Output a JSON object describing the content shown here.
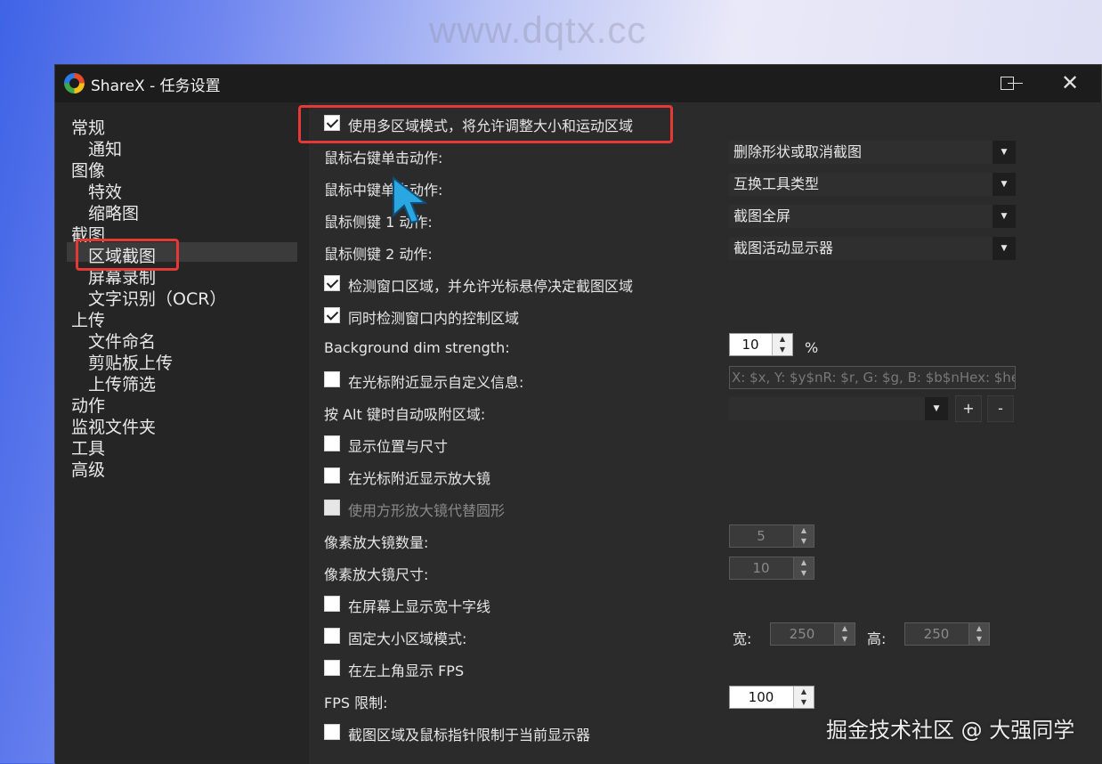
{
  "watermark_top": "www.dqtx.cc",
  "window": {
    "title": "ShareX - 任务设置"
  },
  "sidebar": {
    "items": [
      {
        "label": "常规"
      },
      {
        "label": "通知"
      },
      {
        "label": "图像"
      },
      {
        "label": "特效"
      },
      {
        "label": "缩略图"
      },
      {
        "label": "截图"
      },
      {
        "label": "区域截图"
      },
      {
        "label": "屏幕录制"
      },
      {
        "label": "文字识别（OCR）"
      },
      {
        "label": "上传"
      },
      {
        "label": "文件命名"
      },
      {
        "label": "剪贴板上传"
      },
      {
        "label": "上传筛选"
      },
      {
        "label": "动作"
      },
      {
        "label": "监视文件夹"
      },
      {
        "label": "工具"
      },
      {
        "label": "高级"
      }
    ],
    "selected": "区域截图"
  },
  "settings": {
    "multi_region_mode": {
      "label": "使用多区域模式，将允许调整大小和运动区域",
      "checked": true
    },
    "right_click": {
      "label": "鼠标右键单击动作:",
      "value": "删除形状或取消截图"
    },
    "middle_click": {
      "label": "鼠标中键单击动作:",
      "value": "互换工具类型"
    },
    "x1_click": {
      "label": "鼠标侧键 1 动作:",
      "value": "截图全屏"
    },
    "x2_click": {
      "label": "鼠标侧键 2 动作:",
      "value": "截图活动显示器"
    },
    "detect_windows": {
      "label": "检测窗口区域，并允许光标悬停决定截图区域",
      "checked": true
    },
    "detect_controls": {
      "label": "同时检测窗口内的控制区域",
      "checked": true
    },
    "background_dim": {
      "label": "Background dim strength:",
      "value": "10",
      "unit": "%"
    },
    "custom_info": {
      "label": "在光标附近显示自定义信息:",
      "checked": false,
      "value": "X: $x, Y: $y$nR: $r, G: $g, B: $b$nHex: $hex"
    },
    "alt_snap": {
      "label": "按 Alt 键时自动吸附区域:",
      "add": "+",
      "remove": "-"
    },
    "show_info": {
      "label": "显示位置与尺寸",
      "checked": false
    },
    "show_magnifier": {
      "label": "在光标附近显示放大镜",
      "checked": false
    },
    "square_magnifier": {
      "label": "使用方形放大镜代替圆形",
      "checked": false
    },
    "magnifier_pixel_count": {
      "label": "像素放大镜数量:",
      "value": "5"
    },
    "magnifier_pixel_size": {
      "label": "像素放大镜尺寸:",
      "value": "10"
    },
    "crosshair": {
      "label": "在屏幕上显示宽十字线",
      "checked": false
    },
    "fixed_size": {
      "label": "固定大小区域模式:",
      "checked": false,
      "width_label": "宽:",
      "width": "250",
      "height_label": "高:",
      "height": "250"
    },
    "show_fps": {
      "label": "在左上角显示 FPS",
      "checked": false
    },
    "fps_limit": {
      "label": "FPS 限制:",
      "value": "100"
    },
    "limit_to_monitor": {
      "label": "截图区域及鼠标指针限制于当前显示器",
      "checked": false
    }
  },
  "watermark_bottom": "掘金技术社区 @ 大强同学",
  "colors": {
    "highlight": "#e53935",
    "window_bg": "#252525",
    "content_bg": "#2b2b2b"
  }
}
